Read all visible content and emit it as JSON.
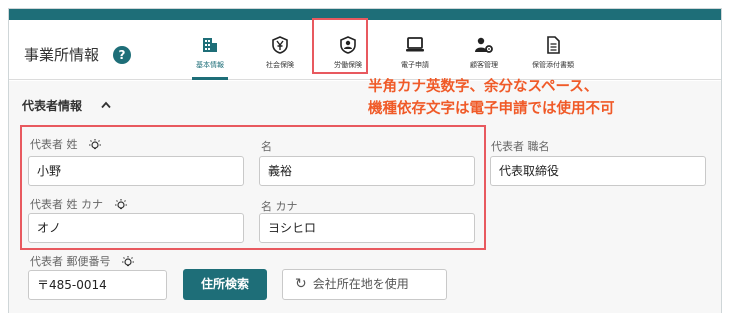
{
  "header": {
    "title": "事業所情報",
    "help": "?"
  },
  "tabs": [
    {
      "label": "基本情報",
      "icon": "building-icon",
      "active": true
    },
    {
      "label": "社会保険",
      "icon": "shield-yen-icon",
      "active": false
    },
    {
      "label": "労働保険",
      "icon": "shield-person-icon",
      "active": false
    },
    {
      "label": "電子申請",
      "icon": "laptop-icon",
      "active": false
    },
    {
      "label": "顧客管理",
      "icon": "user-gear-icon",
      "active": false
    },
    {
      "label": "保管添付書類",
      "icon": "document-icon",
      "active": false
    }
  ],
  "callout": {
    "line1": "半角カナ英数字、余分なスペース、",
    "line2": "機種依存文字は電子申請では使用不可",
    "color": "#f05a28"
  },
  "section": {
    "title": "代表者情報",
    "chevron": "^"
  },
  "form": {
    "last_name_label": "代表者 姓",
    "last_name_value": "小野",
    "first_name_label": "名",
    "first_name_value": "義裕",
    "position_label": "代表者 職名",
    "position_value": "代表取締役",
    "last_kana_label": "代表者 姓 カナ",
    "last_kana_value": "オノ",
    "first_kana_label": "名 カナ",
    "first_kana_value": "ヨシヒロ",
    "postal_label": "代表者 郵便番号",
    "postal_value": "〒485-0014",
    "search_button": "住所検索",
    "use_company_button": "会社所在地を使用"
  },
  "colors": {
    "accent": "#1e6e78",
    "highlight": "#e8595f"
  }
}
